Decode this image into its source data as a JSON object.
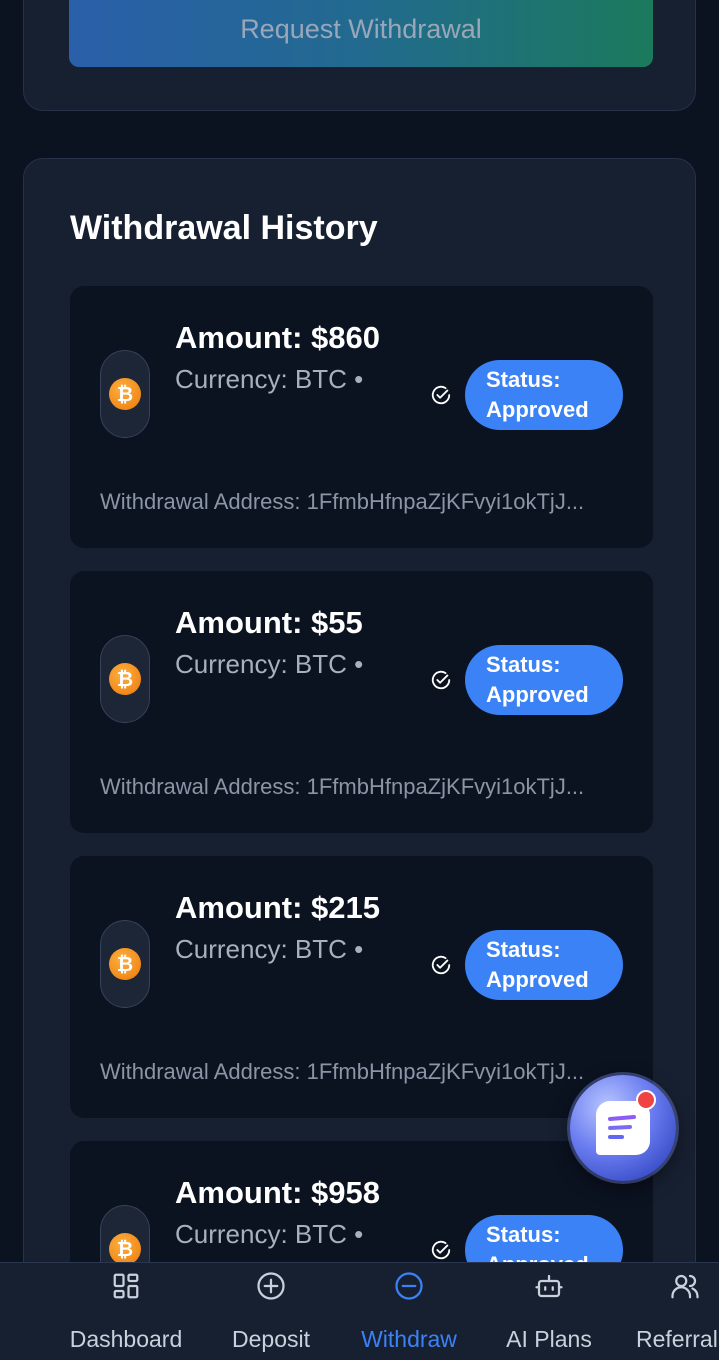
{
  "request_button": {
    "label": "Request Withdrawal"
  },
  "history": {
    "title": "Withdrawal History",
    "items": [
      {
        "amount": "Amount: $860",
        "currency": "Currency: BTC •",
        "status_line1": "Status:",
        "status_line2": "Approved",
        "address": "Withdrawal Address: 1FfmbHfnpaZjKFvyi1okTjJ..."
      },
      {
        "amount": "Amount: $55",
        "currency": "Currency: BTC •",
        "status_line1": "Status:",
        "status_line2": "Approved",
        "address": "Withdrawal Address: 1FfmbHfnpaZjKFvyi1okTjJ..."
      },
      {
        "amount": "Amount: $215",
        "currency": "Currency: BTC •",
        "status_line1": "Status:",
        "status_line2": "Approved",
        "address": "Withdrawal Address: 1FfmbHfnpaZjKFvyi1okTjJ..."
      },
      {
        "amount": "Amount: $958",
        "currency": "Currency: BTC •",
        "status_line1": "Status:",
        "status_line2": "Approved",
        "address": ""
      }
    ]
  },
  "coin_icon": {
    "symbol": "₿"
  },
  "nav": {
    "items": [
      {
        "label": "Dashboard",
        "icon": "dashboard-icon"
      },
      {
        "label": "Deposit",
        "icon": "plus-circle-icon"
      },
      {
        "label": "Withdraw",
        "icon": "minus-circle-icon",
        "active": true
      },
      {
        "label": "AI Plans",
        "icon": "robot-icon"
      },
      {
        "label": "Referral",
        "icon": "users-icon"
      }
    ]
  },
  "colors": {
    "background": "#0b1220",
    "card": "#172031",
    "accent": "#3b82f6",
    "bitcoin": "#f7931a"
  }
}
